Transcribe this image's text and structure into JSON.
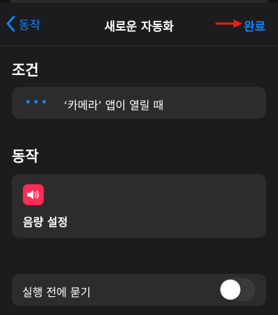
{
  "colors": {
    "accent": "#0a84ff",
    "background": "#1c1c1e",
    "card": "#2c2c2e",
    "volume_icon_bg": "#ff2d55",
    "annotation_arrow": "#e5231b",
    "toggle_off_track": "#3a3a3c"
  },
  "navbar": {
    "back_icon": "chevron-left-icon",
    "back_label": "동작",
    "title": "새로운 자동화",
    "done_label": "완료"
  },
  "conditions": {
    "header": "조건",
    "trigger_icon": "ellipsis-icon",
    "trigger_dots": "•••",
    "trigger_text": "‘카메라’ 앱이 열릴 때"
  },
  "actions": {
    "header": "동작",
    "items": [
      {
        "icon": "speaker-volume-icon",
        "label": "음량 설정"
      }
    ]
  },
  "ask_before_running": {
    "label": "실행 전에 묻기",
    "enabled": false
  }
}
